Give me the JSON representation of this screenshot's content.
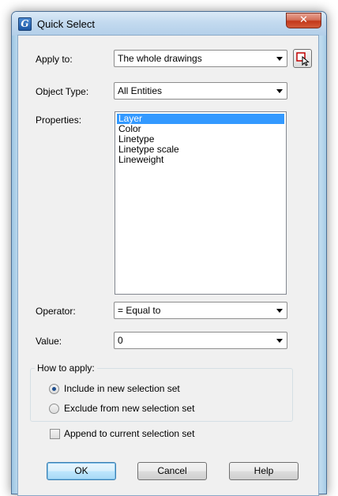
{
  "window": {
    "title": "Quick Select",
    "icon": "app-g-icon",
    "close_glyph": "✕"
  },
  "form": {
    "apply_to_label": "Apply to:",
    "apply_to_value": "The whole drawings",
    "object_type_label": "Object Type:",
    "object_type_value": "All Entities",
    "properties_label": "Properties:",
    "properties": [
      {
        "label": "Layer",
        "selected": true
      },
      {
        "label": "Color",
        "selected": false
      },
      {
        "label": "Linetype",
        "selected": false
      },
      {
        "label": "Linetype scale",
        "selected": false
      },
      {
        "label": "Lineweight",
        "selected": false
      }
    ],
    "operator_label": "Operator:",
    "operator_value": "= Equal to",
    "value_label": "Value:",
    "value_value": "0"
  },
  "how_to_apply": {
    "legend": "How to apply:",
    "options": [
      {
        "label": "Include in new selection set",
        "checked": true
      },
      {
        "label": "Exclude from new selection set",
        "checked": false
      }
    ]
  },
  "append": {
    "label": "Append to current selection set",
    "checked": false
  },
  "buttons": {
    "ok": "OK",
    "cancel": "Cancel",
    "help": "Help"
  },
  "colors": {
    "selection": "#3399ff",
    "frame": "#bcd9ee",
    "close": "#c3381b"
  }
}
